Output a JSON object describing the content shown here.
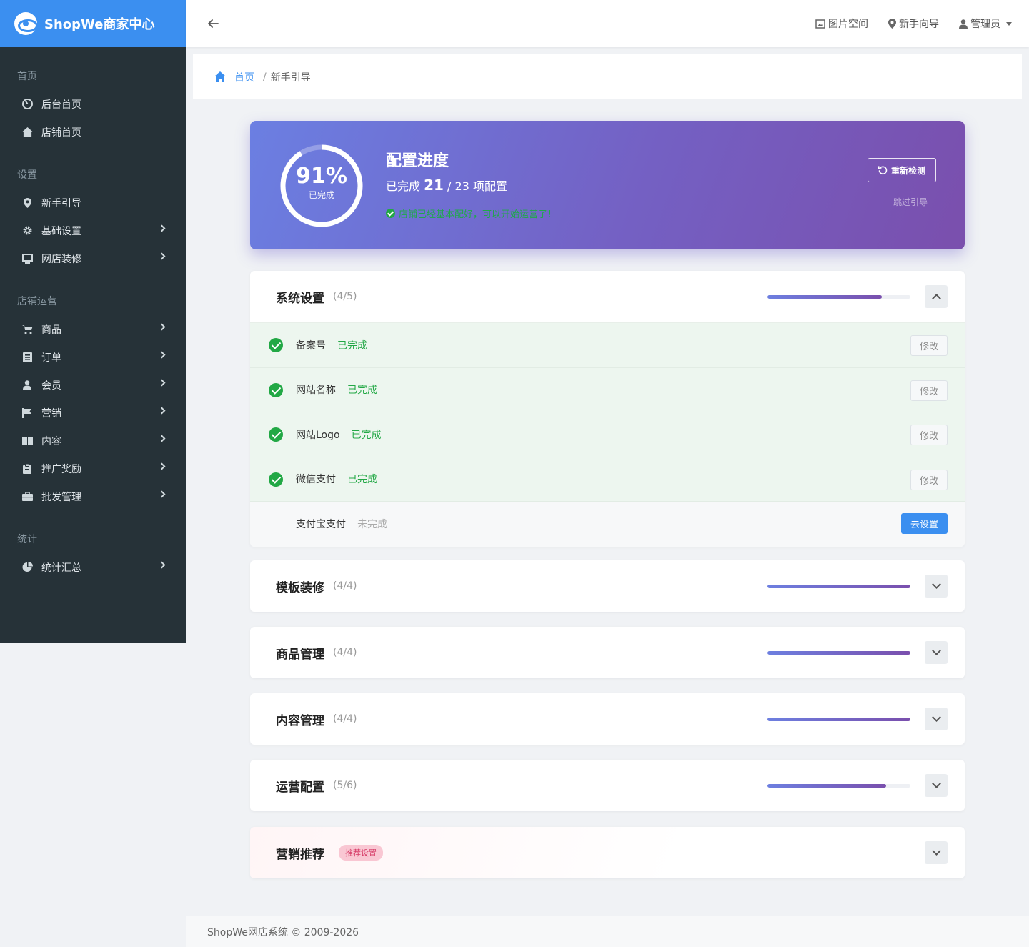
{
  "brand": {
    "name": "ShopWe商家中心"
  },
  "sidebar": {
    "sections": [
      {
        "title": "首页",
        "items": [
          {
            "label": "后台首页",
            "icon": "dashboard-icon",
            "has_children": false
          },
          {
            "label": "店铺首页",
            "icon": "home-icon",
            "has_children": false
          }
        ]
      },
      {
        "title": "设置",
        "items": [
          {
            "label": "新手引导",
            "icon": "map-pin-icon",
            "has_children": false
          },
          {
            "label": "基础设置",
            "icon": "gear-icon",
            "has_children": true
          },
          {
            "label": "网店装修",
            "icon": "monitor-icon",
            "has_children": true
          }
        ]
      },
      {
        "title": "店铺运营",
        "items": [
          {
            "label": "商品",
            "icon": "cart-icon",
            "has_children": true
          },
          {
            "label": "订单",
            "icon": "list-icon",
            "has_children": true
          },
          {
            "label": "会员",
            "icon": "user-icon",
            "has_children": true
          },
          {
            "label": "营销",
            "icon": "flag-icon",
            "has_children": true
          },
          {
            "label": "内容",
            "icon": "book-icon",
            "has_children": true
          },
          {
            "label": "推广奖励",
            "icon": "clipboard-icon",
            "has_children": true
          },
          {
            "label": "批发管理",
            "icon": "briefcase-icon",
            "has_children": true
          }
        ]
      },
      {
        "title": "统计",
        "items": [
          {
            "label": "统计汇总",
            "icon": "pie-chart-icon",
            "has_children": true
          }
        ]
      }
    ]
  },
  "header": {
    "links": [
      {
        "label": "图片空间",
        "icon": "image-icon"
      },
      {
        "label": "新手向导",
        "icon": "map-pin-icon"
      },
      {
        "label": "管理员",
        "icon": "user-icon"
      }
    ]
  },
  "breadcrumb": {
    "home": "首页",
    "separator": "/",
    "current": "新手引导"
  },
  "progress": {
    "percent_label": "91%",
    "percent": 0.91,
    "done_label": "已完成",
    "title": "配置进度",
    "count_prefix": "已完成",
    "completed": "21",
    "total": "23",
    "count_suffix": "项配置",
    "note": "店铺已经基本配好，可以开始运营了!",
    "recheck": "重新检测",
    "skip": "跳过引导"
  },
  "sections": [
    {
      "title": "系统设置",
      "count": "(4/5)",
      "fill": 0.8,
      "expanded": true,
      "rows": [
        {
          "label": "备案号",
          "status": "已完成",
          "done": true,
          "action": "修改"
        },
        {
          "label": "网站名称",
          "status": "已完成",
          "done": true,
          "action": "修改"
        },
        {
          "label": "网站Logo",
          "status": "已完成",
          "done": true,
          "action": "修改"
        },
        {
          "label": "微信支付",
          "status": "已完成",
          "done": true,
          "action": "修改"
        },
        {
          "label": "支付宝支付",
          "status": "未完成",
          "done": false,
          "action": "去设置"
        }
      ]
    },
    {
      "title": "模板装修",
      "count": "(4/4)",
      "fill": 1.0,
      "expanded": false
    },
    {
      "title": "商品管理",
      "count": "(4/4)",
      "fill": 1.0,
      "expanded": false
    },
    {
      "title": "内容管理",
      "count": "(4/4)",
      "fill": 1.0,
      "expanded": false
    },
    {
      "title": "运营配置",
      "count": "(5/6)",
      "fill": 0.833,
      "expanded": false
    }
  ],
  "recommend": {
    "title": "营销推荐",
    "badge": "推荐设置"
  },
  "footer": {
    "text": "ShopWe网店系统 © 2009-2026"
  },
  "colors": {
    "accent": "#3b8ff0",
    "sidebar": "#263238",
    "success": "#22a845",
    "gradient_start": "#6b7fe2",
    "gradient_end": "#7a4fad"
  }
}
